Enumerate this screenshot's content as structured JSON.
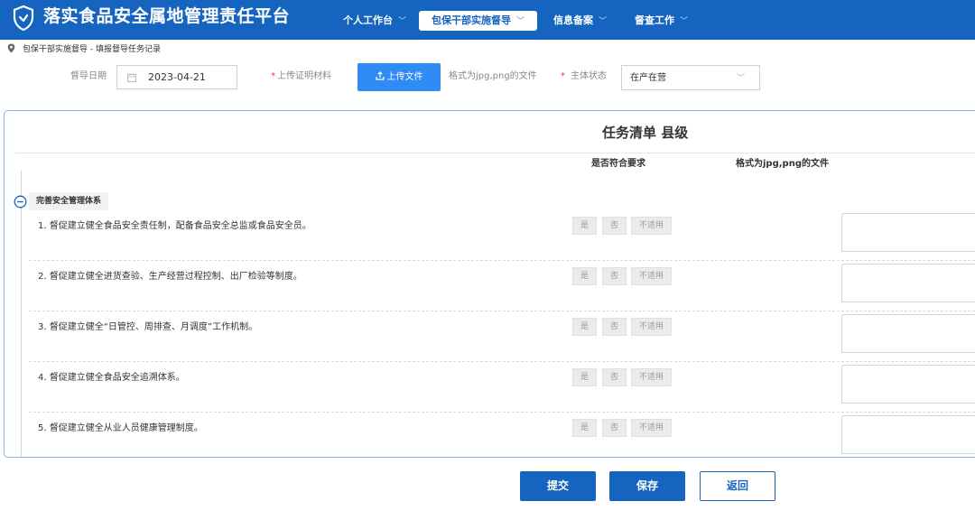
{
  "header": {
    "title": "落实食品安全属地管理责任平台",
    "nav": [
      {
        "label": "个人工作台",
        "chevron": "﹀"
      },
      {
        "label": "包保干部实施督导",
        "chevron": "﹀"
      },
      {
        "label": "信息备案",
        "chevron": "﹀"
      },
      {
        "label": "督查工作",
        "chevron": "﹀"
      }
    ],
    "active_nav": "包保干部实施督导"
  },
  "breadcrumb": "包保干部实施督导 - 填报督导任务记录",
  "form": {
    "date_label": "督导日期",
    "date_value": "2023-04-21",
    "upload_label": "上传证明材料",
    "upload_button": "上传文件",
    "upload_hint": "格式为jpg,png的文件",
    "status_label": "主体状态",
    "status_value": "在产在营",
    "required_mark": "*"
  },
  "panel": {
    "title": "任务清单  县级",
    "col_compliance": "是否符合要求",
    "col_file": "格式为jpg,png的文件",
    "section": "完善安全管理体系",
    "option_labels": {
      "yes": "是",
      "no": "否",
      "na": "不适用"
    },
    "items": [
      "1. 督促建立健全食品安全责任制，配备食品安全总监或食品安全员。",
      "2. 督促建立健全进货查验、生产经营过程控制、出厂检验等制度。",
      "3. 督促建立健全“日管控、周排查、月调度”工作机制。",
      "4. 督促建立健全食品安全追溯体系。",
      "5. 督促建立健全从业人员健康管理制度。"
    ]
  },
  "buttons": {
    "submit": "提交",
    "save": "保存",
    "back": "返回"
  },
  "colors": {
    "brand": "#1565c0",
    "upload": "#2f8bf5",
    "required": "#e53935"
  },
  "icons": {
    "logo": "shield-icon",
    "location": "location-pin-icon",
    "calendar": "calendar-icon",
    "upload": "upload-icon",
    "collapse": "minus-circle-icon"
  }
}
